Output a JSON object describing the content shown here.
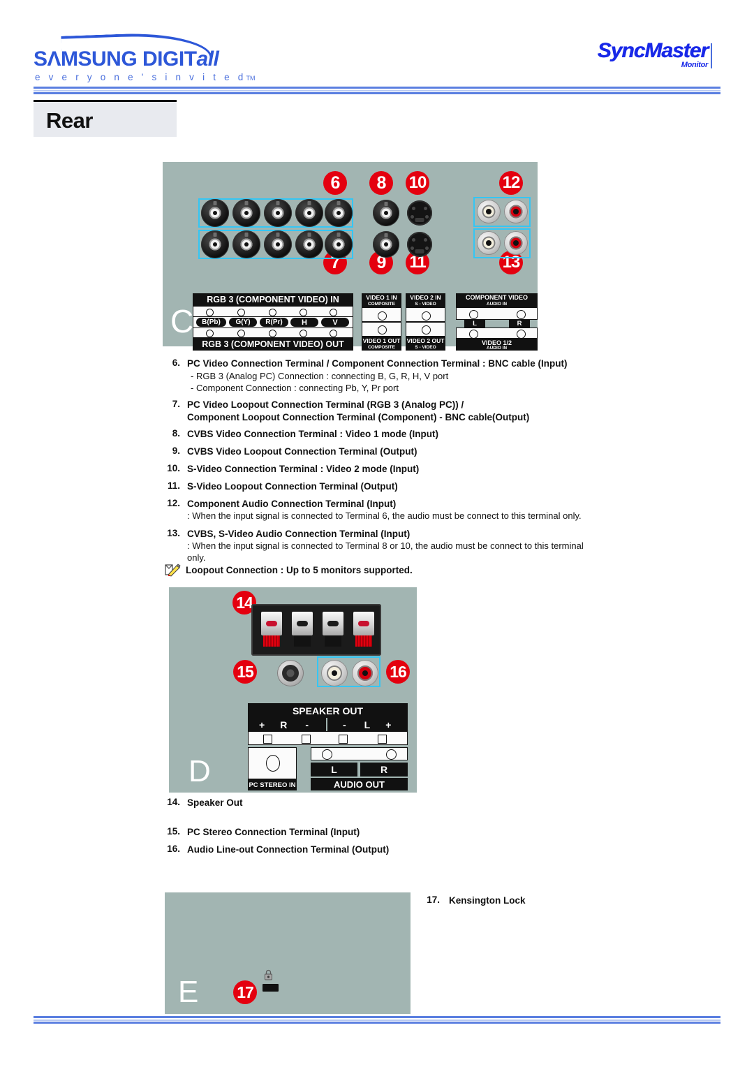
{
  "header": {
    "brand_wordmark_main": "SΛMSUNG DIGIT",
    "brand_wordmark_italic": "all",
    "brand_tagline": "e v e r y o n e ' s   i n v i t e d",
    "brand_tagline_tm": "TM",
    "product_logo": "SyncMaster",
    "product_logo_sub": "Monitor",
    "accent_blue": "#2d57d8",
    "rule_blue": "#5b7fe0"
  },
  "page": {
    "title": "Rear",
    "panel_bg": "#a2b5b2",
    "badge_color": "#e4000f",
    "highlight_color": "#34c6f4"
  },
  "panel_c": {
    "letter": "C",
    "badges": [
      "6",
      "7",
      "8",
      "9",
      "10",
      "11",
      "12",
      "13"
    ],
    "silk": {
      "rgb_in": "RGB 3 (COMPONENT VIDEO) IN",
      "rgb_out": "RGB 3 (COMPONENT VIDEO) OUT",
      "pins": [
        "B(Pb)",
        "G(Y)",
        "R(Pr)",
        "H",
        "V"
      ],
      "video1_in": "VIDEO 1 IN",
      "video1_in_sub": "COMPOSITE",
      "video1_out": "VIDEO 1 OUT",
      "video1_out_sub": "COMPOSITE",
      "video2_in": "VIDEO 2 IN",
      "video2_in_sub": "S - VIDEO",
      "video2_out": "VIDEO 2 OUT",
      "video2_out_sub": "S - VIDEO",
      "component_audio_in": "COMPONENT VIDEO",
      "component_audio_in_sub": "AUDIO IN",
      "lr_left": "L",
      "lr_right": "R",
      "video12": "VIDEO 1/2",
      "video12_sub": "AUDIO IN"
    }
  },
  "panel_d": {
    "letter": "D",
    "badges": [
      "14",
      "15",
      "16"
    ],
    "silk": {
      "speaker_out": "SPEAKER OUT",
      "r_plus": "+",
      "r_label": "R",
      "r_minus": "-",
      "l_minus": "-",
      "l_label": "L",
      "l_plus": "+",
      "pc_stereo_in": "PC STEREO IN",
      "audio_out": "AUDIO OUT",
      "audio_l": "L",
      "audio_r": "R"
    }
  },
  "panel_e": {
    "letter": "E",
    "badges": [
      "17"
    ]
  },
  "items": [
    {
      "num": "6.",
      "title": "PC Video Connection Terminal / Component Connection Terminal : BNC cable (Input)",
      "sub": "- RGB 3 (Analog PC) Connection : connecting B, G, R, H, V port\n- Component Connection : connecting Pb, Y, Pr port"
    },
    {
      "num": "7.",
      "title": "PC Video Loopout Connection Terminal (RGB 3 (Analog PC)) /\nComponent Loopout Connection Terminal (Component) - BNC cable(Output)",
      "sub": ""
    },
    {
      "num": "8.",
      "title": "CVBS Video Connection Terminal : Video 1 mode (Input)",
      "sub": ""
    },
    {
      "num": "9.",
      "title": "CVBS Video Loopout Connection Terminal (Output)",
      "sub": ""
    },
    {
      "num": "10.",
      "title": "S-Video Connection Terminal : Video 2 mode (Input)",
      "sub": ""
    },
    {
      "num": "11.",
      "title": "S-Video Loopout Connection Terminal (Output)",
      "sub": ""
    },
    {
      "num": "12.",
      "title": "Component Audio Connection Terminal (Input)",
      "sub": ": When the input signal is connected to Terminal 6, the audio must be connect to this terminal only."
    },
    {
      "num": "13.",
      "title": "CVBS, S-Video Audio Connection Terminal (Input)",
      "sub": ": When the input signal is connected to Terminal 8 or 10, the audio must be connect to this terminal\nonly."
    },
    {
      "num": "14.",
      "title": "Speaker Out",
      "sub": ""
    },
    {
      "num": "15.",
      "title": "PC Stereo Connection Terminal (Input)",
      "sub": ""
    },
    {
      "num": "16.",
      "title": "Audio Line-out Connection Terminal (Output)",
      "sub": ""
    },
    {
      "num": "17.",
      "title": "Kensington Lock",
      "sub": ""
    }
  ],
  "note": {
    "icon": "note-pencil-icon",
    "text": "Loopout Connection : Up to 5 monitors supported."
  }
}
